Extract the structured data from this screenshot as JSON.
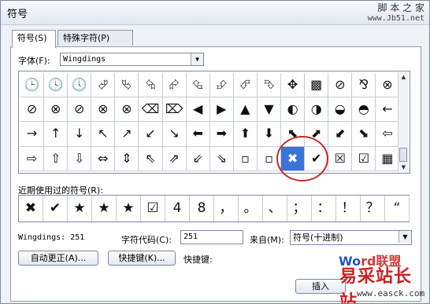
{
  "window": {
    "title": "符号",
    "watermark_top": "脚 本 之 家",
    "watermark_url": "www.Jb51.net"
  },
  "tabs": [
    {
      "label": "符号(S)"
    },
    {
      "label": "特殊字符(P)"
    }
  ],
  "font": {
    "label": "字体(F):",
    "value": "Wingdings"
  },
  "symbol_grid": [
    [
      "🕒",
      "🕓",
      "🕔",
      "⮰",
      "⮱",
      "⮲",
      "⮳",
      "⮴",
      "⮵",
      "⮶",
      "⮷",
      "✥",
      "▩",
      "⊘",
      "⅋",
      "⊗"
    ],
    [
      "⊘",
      "⊗",
      "⊘",
      "⊗",
      "⊗",
      "⌫",
      "⌦",
      "◀",
      "▶",
      "▲",
      "▼",
      "◐",
      "◑",
      "◒",
      "◓",
      "←"
    ],
    [
      "→",
      "↑",
      "↓",
      "↖",
      "↗",
      "↙",
      "↘",
      "⬅",
      "➡",
      "⬆",
      "⬇",
      "⬉",
      "⬈",
      "⬋",
      "⬊",
      "⇦"
    ],
    [
      "⇨",
      "⇧",
      "⇩",
      "⇔",
      "⇕",
      "⇖",
      "⇗",
      "⇙",
      "⇘",
      "▫",
      "▫",
      "✖",
      "✔",
      "☒",
      "☑",
      "▦"
    ]
  ],
  "selected_symbol": "✖",
  "recent": {
    "label": "近期使用过的符号(R):",
    "symbols": [
      "✖",
      "✔",
      "★",
      "★",
      "★",
      "☑",
      "4",
      "8",
      "，",
      "。",
      "、",
      "；",
      "：",
      "！",
      "？",
      "“"
    ]
  },
  "info": {
    "font_code": "Wingdings: 251",
    "code_label": "字符代码(C):",
    "code_value": "251",
    "from_label": "来自(M):",
    "from_value": "符号(十进制)"
  },
  "buttons": {
    "autocorrect": "自动更正(A)...",
    "shortcut": "快捷键(K)...",
    "shortcut_label": "快捷键:",
    "insert": "插入"
  },
  "brand": {
    "word_blue": "Wo",
    "word_red": "rd",
    "word_cn": "联盟",
    "cn": "易采站长站",
    "url": "www.easck.com"
  }
}
